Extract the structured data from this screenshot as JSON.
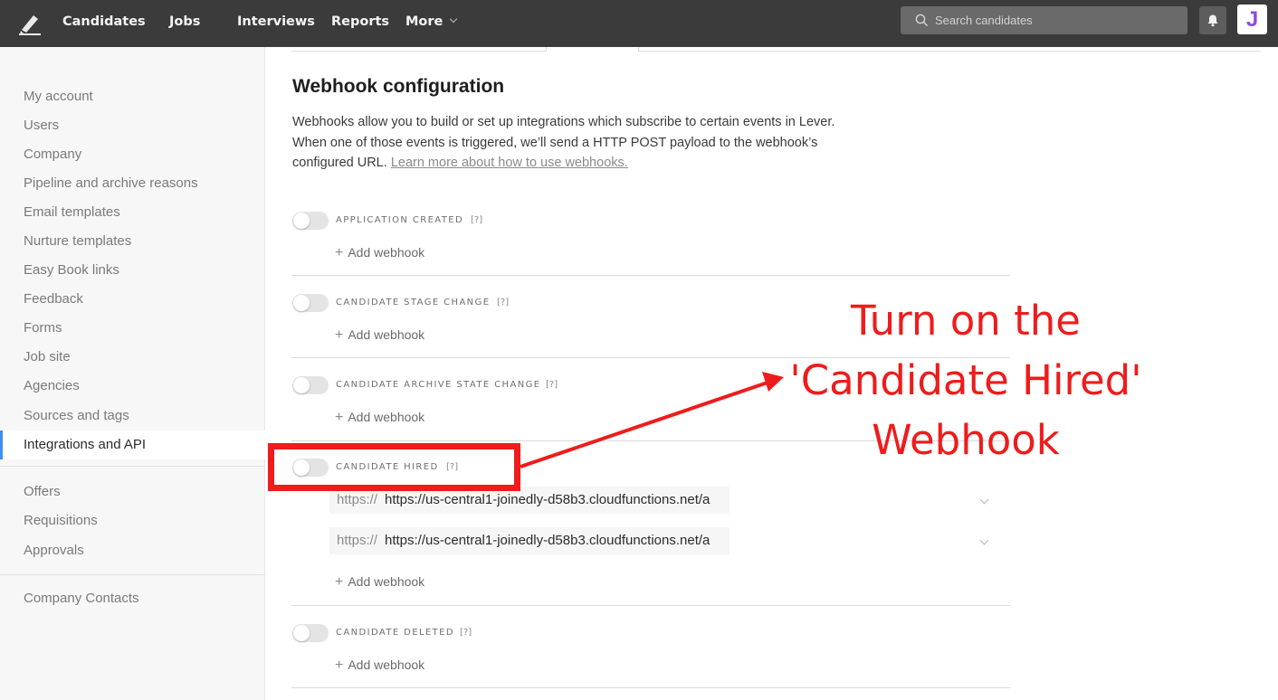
{
  "topnav": {
    "logo_icon": "lever-pen-logo-icon",
    "items": [
      {
        "label": "Candidates"
      },
      {
        "label": "Jobs"
      },
      {
        "label": "Interviews"
      },
      {
        "label": "Reports"
      },
      {
        "label": "More"
      }
    ],
    "search": {
      "placeholder": "Search candidates",
      "value": "",
      "icon": "search-icon"
    },
    "notifications_icon": "bell-icon",
    "avatar_letter": "J",
    "avatar_color": "#8a4ce8"
  },
  "sidebar": {
    "groups": [
      {
        "items": [
          {
            "label": "My account"
          },
          {
            "label": "Users"
          },
          {
            "label": "Company"
          },
          {
            "label": "Pipeline and archive reasons"
          },
          {
            "label": "Email templates"
          },
          {
            "label": "Nurture templates"
          },
          {
            "label": "Easy Book links"
          },
          {
            "label": "Feedback"
          },
          {
            "label": "Forms"
          },
          {
            "label": "Job site"
          },
          {
            "label": "Agencies"
          },
          {
            "label": "Sources and tags"
          },
          {
            "label": "Integrations and API",
            "active": true
          }
        ]
      },
      {
        "items": [
          {
            "label": "Offers"
          },
          {
            "label": "Requisitions"
          },
          {
            "label": "Approvals"
          }
        ]
      },
      {
        "items": [
          {
            "label": "Company Contacts"
          }
        ]
      }
    ],
    "active_color": "#3e8ef7"
  },
  "main": {
    "title": "Webhook configuration",
    "description_text": "Webhooks allow you to build or set up integrations which subscribe to certain events in Lever. When one of those events is triggered, we’ll send a HTTP POST payload to the webhook’s configured URL.",
    "description_link": "Learn more about how to use webhooks.",
    "help_label": "[?]",
    "add_webhook_label": "Add webhook",
    "events": [
      {
        "label": "APPLICATION CREATED",
        "enabled": false,
        "urls": []
      },
      {
        "label": "CANDIDATE STAGE CHANGE",
        "enabled": false,
        "urls": []
      },
      {
        "label": "CANDIDATE ARCHIVE STATE CHANGE",
        "enabled": false,
        "urls": []
      },
      {
        "label": "CANDIDATE HIRED",
        "enabled": false,
        "urls": [
          {
            "prefix": "https://",
            "value": "https://us-central1-joinedly-d58b3.cloudfunctions.net/a"
          },
          {
            "prefix": "https://",
            "value": "https://us-central1-joinedly-d58b3.cloudfunctions.net/a"
          }
        ]
      },
      {
        "label": "CANDIDATE DELETED",
        "enabled": false,
        "urls": []
      }
    ]
  },
  "annotation": {
    "lines": [
      "Turn on the",
      "'Candidate Hired'",
      "Webhook"
    ],
    "color": "#ee1c1c"
  }
}
